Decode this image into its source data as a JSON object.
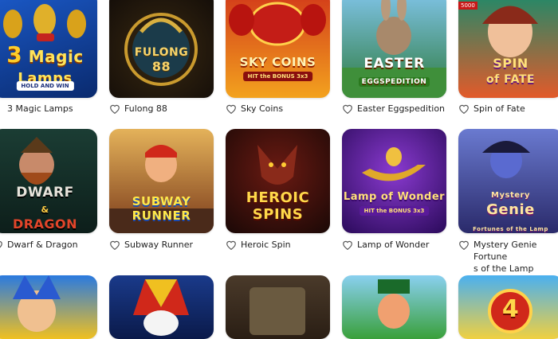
{
  "games": [
    {
      "title": "3 Magic Lamps",
      "logo_line1": "3",
      "logo_line2": "Magic",
      "logo_line3": "Lamps",
      "badge": "HOLD AND WIN"
    },
    {
      "title": "Fulong 88",
      "logo_line1": "FULONG",
      "logo_line2": "88"
    },
    {
      "title": "Sky Coins",
      "logo_line1": "SKY COINS",
      "badge": "HIT the BONUS 3x3"
    },
    {
      "title": "Easter Eggspedition",
      "logo_line1": "EASTER",
      "logo_line2": "EGGSPEDITION"
    },
    {
      "title": "Spin of Fate",
      "logo_line1": "SPIN",
      "logo_line2": "of FATE",
      "corner": "5000"
    },
    {
      "title": "Dwarf & Dragon",
      "logo_line1": "DWARF",
      "logo_line2": "&",
      "logo_line3": "DRAGON"
    },
    {
      "title": "Subway Runner",
      "logo_line1": "SUBWAY",
      "logo_line2": "RUNNER"
    },
    {
      "title": "Heroic Spin",
      "logo_line1": "HEROIC",
      "logo_line2": "SPINS"
    },
    {
      "title": "Lamp of Wonder",
      "logo_line1": "Lamp of Wonder",
      "badge": "HIT the BONUS 3x3"
    },
    {
      "title": "Mystery Genie Fortune",
      "title_line2": "s of the Lamp",
      "logo_line1": "Mystery",
      "logo_line2": "Genie",
      "logo_line3": "Fortunes of the Lamp"
    },
    {
      "logo_line1": ""
    },
    {
      "logo_line1": ""
    },
    {
      "logo_line1": ""
    },
    {
      "logo_line1": ""
    },
    {
      "logo_line1": "4"
    }
  ],
  "colors": {
    "caption_text": "#222222",
    "heart_stroke": "#555555"
  }
}
